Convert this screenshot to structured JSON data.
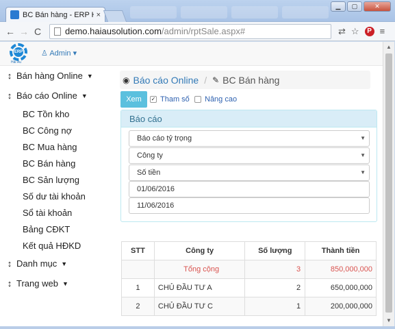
{
  "browser": {
    "tab_title": "BC Bán hàng - ERP Hải Âu",
    "tab_close": "×",
    "url_host": "demo.haiausolution.com",
    "url_path": "/admin/rptSale.aspx#",
    "window_controls": {
      "minimize": "▁",
      "maximize": "▢",
      "close": "✕"
    },
    "toolbar_glyphs": {
      "back": "←",
      "forward": "→",
      "reload": "C",
      "translate": "⇄",
      "star": "☆",
      "pinterest": "P",
      "menu": "≡"
    }
  },
  "header": {
    "logo_text": "ERP",
    "logo_sub": "Hải Âu",
    "user_label": "Admin"
  },
  "sidebar": {
    "groups": [
      {
        "label": "Bán hàng Online"
      },
      {
        "label": "Báo cáo Online"
      },
      {
        "label": "Danh mục"
      },
      {
        "label": "Trang web"
      }
    ],
    "sub_items": [
      {
        "label": "BC Tồn kho"
      },
      {
        "label": "BC Công nợ"
      },
      {
        "label": "BC Mua hàng"
      },
      {
        "label": "BC Bán hàng"
      },
      {
        "label": "BC Sản lượng"
      },
      {
        "label": "Số dư tài khoản"
      },
      {
        "label": "Sổ tài khoản"
      },
      {
        "label": "Bảng CĐKT"
      },
      {
        "label": "Kết quả HĐKD"
      }
    ]
  },
  "breadcrumb": {
    "parent": "Báo cáo Online",
    "separator": "/",
    "current": "BC Bán hàng"
  },
  "actions": {
    "view_button": "Xem",
    "param_label": "Tham số",
    "param_checked": true,
    "advanced_label": "Nâng cao",
    "advanced_checked": false
  },
  "report_panel": {
    "title": "Báo cáo",
    "selects": [
      {
        "value": "Báo cáo tỷ trọng"
      },
      {
        "value": "Công ty"
      },
      {
        "value": "Số tiền"
      }
    ],
    "date_from": "01/06/2016",
    "date_to": "11/06/2016"
  },
  "table": {
    "headers": {
      "stt": "STT",
      "company": "Công ty",
      "qty": "Số lượng",
      "amount": "Thành tiền"
    },
    "total": {
      "label": "Tổng cộng",
      "qty": "3",
      "amount": "850,000,000"
    },
    "rows": [
      {
        "stt": "1",
        "company": "CHỦ ĐẦU TƯ A",
        "qty": "2",
        "amount": "650,000,000"
      },
      {
        "stt": "2",
        "company": "CHỦ ĐẦU TƯ C",
        "qty": "1",
        "amount": "200,000,000"
      }
    ]
  },
  "colors": {
    "accent": "#337ab7",
    "info_button": "#5bc0de",
    "panel_head": "#d9edf7",
    "total_text": "#d9534f"
  }
}
